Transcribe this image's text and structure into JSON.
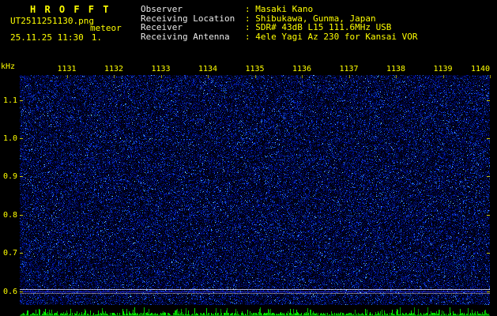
{
  "header": {
    "title": "H R O F F T",
    "filename": "UT2511251130.png",
    "station": "meteor",
    "datetime": "25.11.25 11:30",
    "counter": "1.",
    "info": [
      {
        "label": "Observer",
        "value": ": Masaki Kano"
      },
      {
        "label": "Receiving Location",
        "value": ": Shibukawa, Gunma, Japan"
      },
      {
        "label": "Receiver",
        "value": ": SDR# 43dB L15 111.6MHz USB"
      },
      {
        "label": "Receiving Antenna",
        "value": ": 4ele Yagi Az 230 for Kansai VOR"
      }
    ]
  },
  "spectrogram": {
    "y_unit": "kHz",
    "y_labels": [
      "1.1",
      "1.0",
      "0.9",
      "0.8",
      "0.7",
      "0.6"
    ],
    "x_labels": [
      "1131",
      "1132",
      "1133",
      "1134",
      "1135",
      "1136",
      "1137",
      "1138",
      "1139",
      "1140"
    ],
    "carrier_lines": [
      {
        "khz": 0.605,
        "intensity": "bright"
      },
      {
        "khz": 0.6,
        "intensity": "blue"
      },
      {
        "khz": 0.594,
        "intensity": "dim"
      }
    ],
    "colors": {
      "axis_text": "#ffff00",
      "info_label": "#e8e8e8",
      "noise_dim": "#000060",
      "noise_bright": "#4a9aff",
      "carrier": "#b8b8c8",
      "meter_green": "#00dd00",
      "background": "#000012"
    }
  }
}
